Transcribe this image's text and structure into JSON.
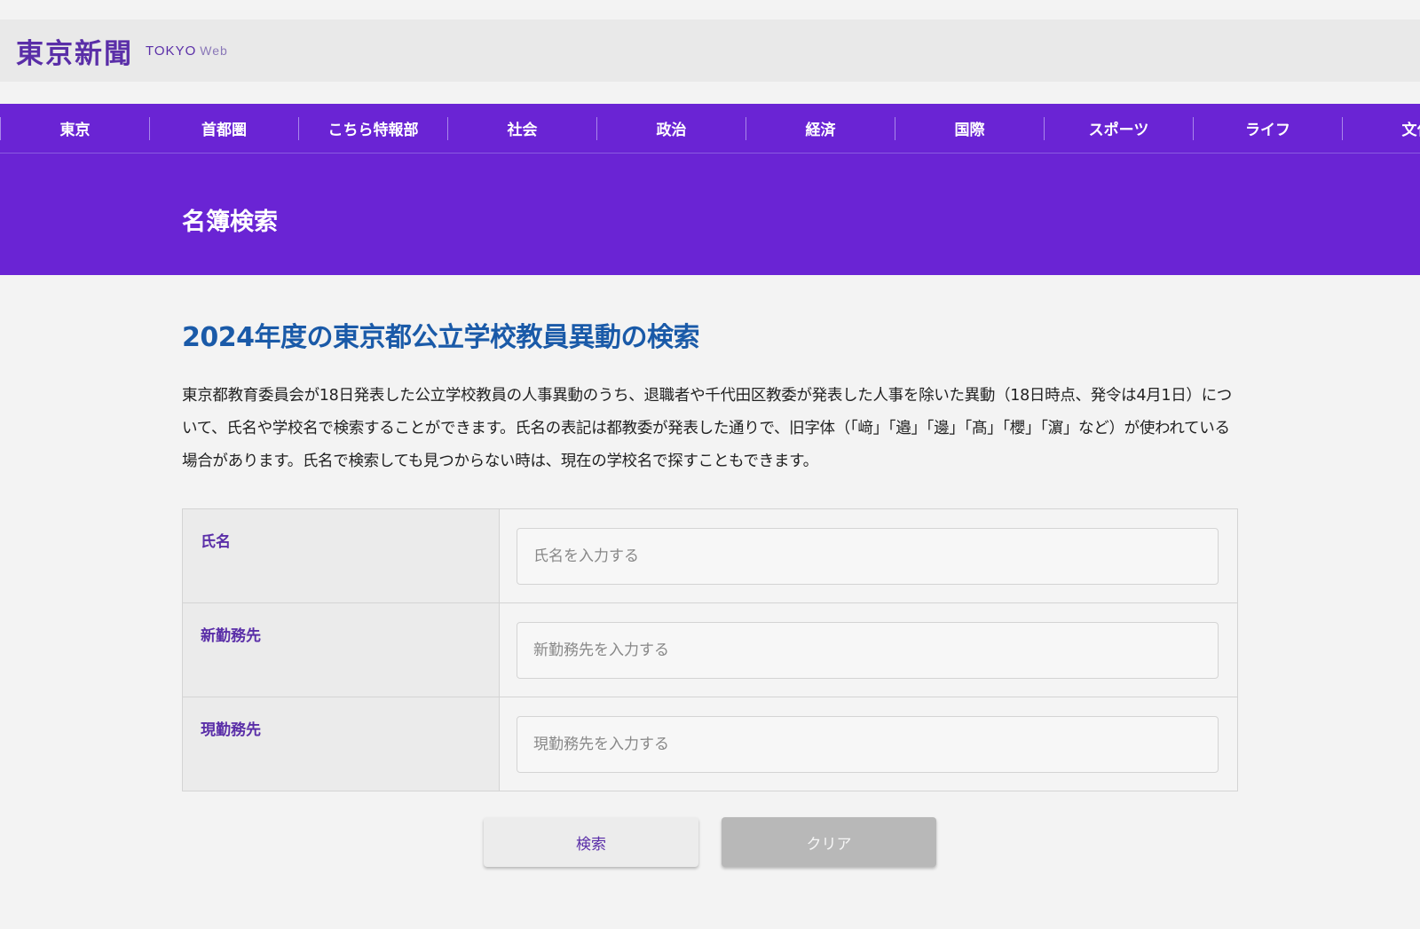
{
  "header": {
    "logo_main": "東京新聞",
    "logo_sub": "TOKYO",
    "logo_web": "Web"
  },
  "nav": {
    "items": [
      {
        "label": "東京"
      },
      {
        "label": "首都圏"
      },
      {
        "label": "こちら特報部"
      },
      {
        "label": "社会"
      },
      {
        "label": "政治"
      },
      {
        "label": "経済"
      },
      {
        "label": "国際"
      },
      {
        "label": "スポーツ"
      },
      {
        "label": "ライフ"
      },
      {
        "label": "文化"
      }
    ]
  },
  "banner": {
    "title": "名簿検索"
  },
  "main": {
    "title": "2024年度の東京都公立学校教員異動の検索",
    "description": "東京都教育委員会が18日発表した公立学校教員の人事異動のうち、退職者や千代田区教委が発表した人事を除いた異動（18日時点、発令は4月1日）について、氏名や学校名で検索することができます。氏名の表記は都教委が発表した通りで、旧字体（「﨑」「邉」「邊」「髙」「櫻」「濵」など）が使われている場合があります。氏名で検索しても見つからない時は、現在の学校名で探すこともできます。"
  },
  "form": {
    "fields": [
      {
        "label": "氏名",
        "placeholder": "氏名を入力する",
        "value": ""
      },
      {
        "label": "新勤務先",
        "placeholder": "新勤務先を入力する",
        "value": ""
      },
      {
        "label": "現勤務先",
        "placeholder": "現勤務先を入力する",
        "value": ""
      }
    ],
    "search_label": "検索",
    "clear_label": "クリア"
  },
  "colors": {
    "brand_purple": "#6a24d4",
    "title_blue": "#1a5aa8",
    "label_purple": "#5a2ea8"
  }
}
